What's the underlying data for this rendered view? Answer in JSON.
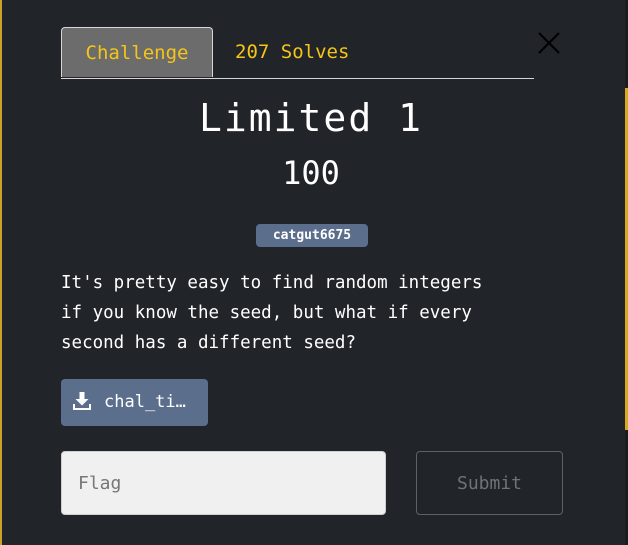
{
  "tabs": {
    "challenge": "Challenge",
    "solves": "207 Solves"
  },
  "challenge": {
    "title": "Limited 1",
    "points": "100",
    "author": "catgut6675",
    "description": "It's pretty easy to find random integers\nif you know the seed, but what if every\nsecond has a different seed?"
  },
  "file": {
    "label": "chal_ti…",
    "icon": "download-icon"
  },
  "form": {
    "flag_placeholder": "Flag",
    "flag_value": "",
    "submit_label": "Submit"
  },
  "colors": {
    "accent": "#f5c518",
    "badge": "#5b6e8c",
    "background": "#212429",
    "active_tab": "#6c6c6c"
  }
}
